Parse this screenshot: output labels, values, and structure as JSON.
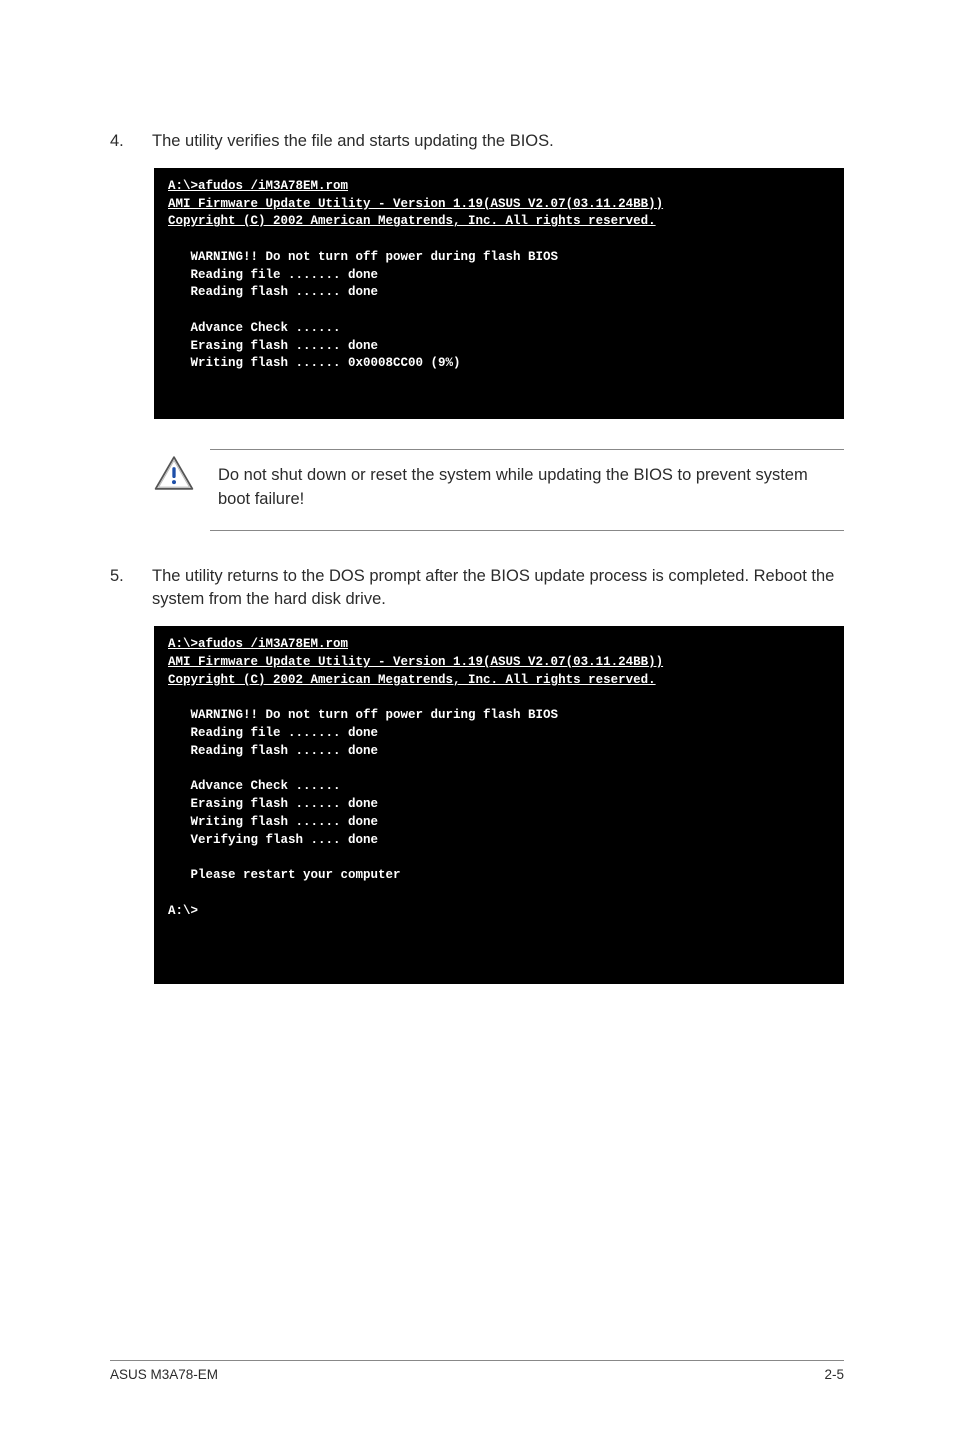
{
  "step4": {
    "num": "4.",
    "text": "The utility verifies the file and starts updating the BIOS."
  },
  "terminal1": {
    "cmd": "A:\\>afudos /iM3A78EM.rom",
    "line1": "AMI Firmware Update Utility - Version 1.19(ASUS V2.07(03.11.24BB))",
    "line2": "Copyright (C) 2002 American Megatrends, Inc. All rights reserved.",
    "body": "   WARNING!! Do not turn off power during flash BIOS\n   Reading file ....... done\n   Reading flash ...... done\n\n   Advance Check ......\n   Erasing flash ...... done\n   Writing flash ...... 0x0008CC00 (9%)\n\n\n"
  },
  "callout": {
    "text": "Do not shut down or reset the system while updating the BIOS to prevent system boot failure!"
  },
  "step5": {
    "num": "5.",
    "text": "The utility returns to the DOS prompt after the BIOS update process is completed. Reboot the system from the hard disk drive."
  },
  "terminal2": {
    "cmd": "A:\\>afudos /iM3A78EM.rom",
    "line1": "AMI Firmware Update Utility - Version 1.19(ASUS V2.07(03.11.24BB))",
    "line2": "Copyright (C) 2002 American Megatrends, Inc. All rights reserved.",
    "body": "   WARNING!! Do not turn off power during flash BIOS\n   Reading file ....... done\n   Reading flash ...... done\n\n   Advance Check ......\n   Erasing flash ...... done\n   Writing flash ...... done\n   Verifying flash .... done\n\n   Please restart your computer\n\nA:\\>\n\n\n\n"
  },
  "footer": {
    "left": "ASUS M3A78-EM",
    "right": "2-5"
  }
}
